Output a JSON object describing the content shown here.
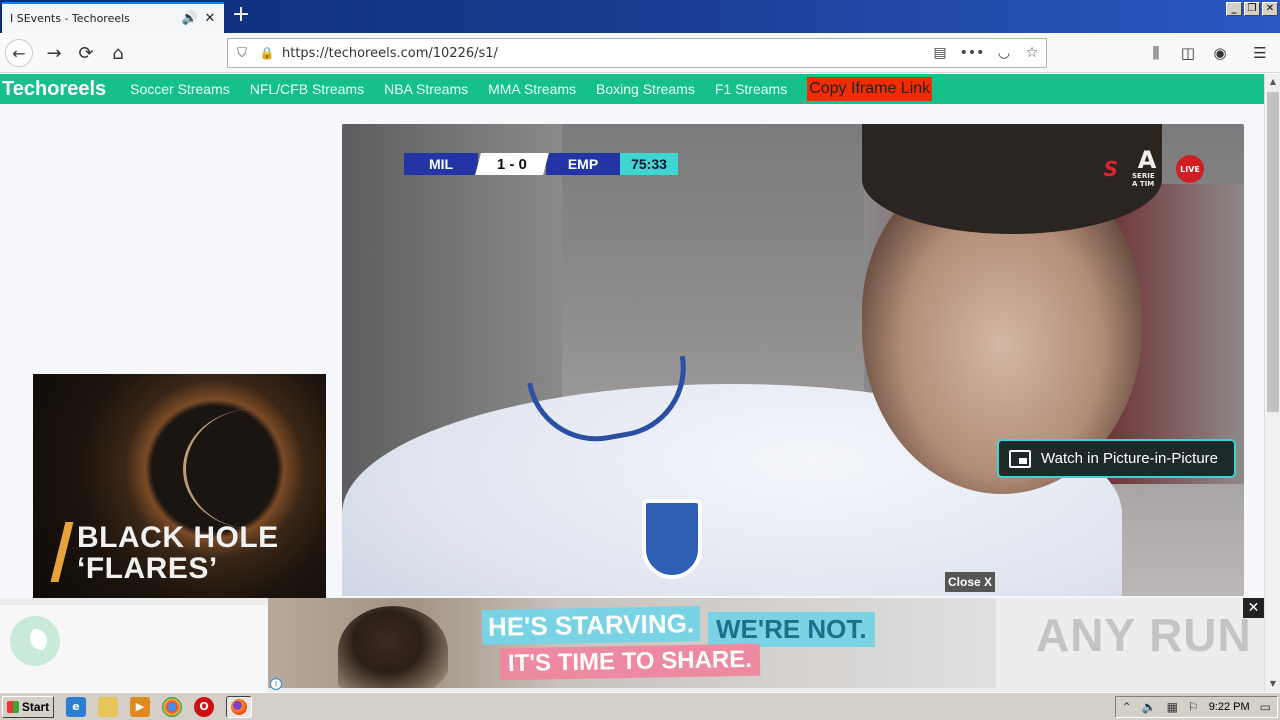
{
  "browser": {
    "tab_title": "I SEvents - Techoreels",
    "tab_audio_icon": "speaker-icon",
    "tab_close": "✕",
    "new_tab": "+",
    "url": "https://techoreels.com/10226/s1/"
  },
  "site": {
    "brand": "Techoreels",
    "nav": [
      "Soccer Streams",
      "NFL/CFB Streams",
      "NBA Streams",
      "MMA Streams",
      "Boxing Streams",
      "F1 Streams"
    ],
    "copy_link": "Copy Iframe Link"
  },
  "ad_left": {
    "headline_line1": "BLACK HOLE",
    "headline_line2": "‘FLARES’"
  },
  "video": {
    "team_home": "MIL",
    "score": "1 - 0",
    "team_away": "EMP",
    "clock": "75:33",
    "live_badge": "LIVE",
    "serie_a_caption": "SERIE A TIM",
    "pip_label": "Watch in Picture-in-Picture"
  },
  "close_ad": "Close X",
  "banner_ad": {
    "line1a": "HE'S STARVING.",
    "line1b": "WE'RE NOT.",
    "line2": "IT'S TIME TO SHARE.",
    "info": "i",
    "close": "✕",
    "watermark": "ANY RUN"
  },
  "taskbar": {
    "start": "Start",
    "clock": "9:22 PM"
  },
  "colors": {
    "site_nav": "#16c08b",
    "copy_link_bg": "#f02d00",
    "score_blue": "#2335a4",
    "clock_cyan": "#3fd6d2",
    "pip_border": "#35d7d0"
  }
}
